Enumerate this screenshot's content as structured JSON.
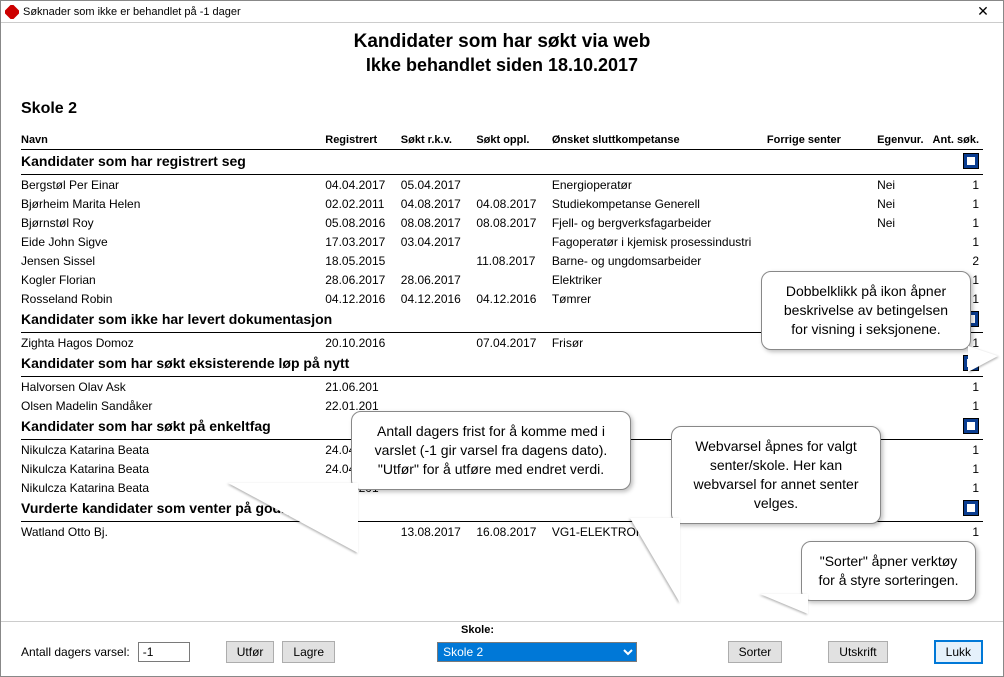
{
  "window": {
    "title": "Søknader som ikke er behandlet på -1 dager",
    "close": "✕"
  },
  "header": {
    "line1": "Kandidater som har søkt via web",
    "line2": "Ikke behandlet siden 18.10.2017"
  },
  "school": "Skole 2",
  "columns": {
    "navn": "Navn",
    "reg": "Registrert",
    "rkv": "Søkt r.k.v.",
    "oppl": "Søkt oppl.",
    "komp": "Ønsket sluttkompetanse",
    "fs": "Forrige senter",
    "eg": "Egenvur.",
    "ant": "Ant. søk."
  },
  "sections": [
    {
      "title": "Kandidater som har registrert seg",
      "rows": [
        {
          "navn": "Bergstøl Per Einar",
          "reg": "04.04.2017",
          "rkv": "05.04.2017",
          "oppl": "",
          "komp": "Energioperatør",
          "fs": "",
          "eg": "Nei",
          "ant": "1"
        },
        {
          "navn": "Bjørheim Marita Helen",
          "reg": "02.02.2011",
          "rkv": "04.08.2017",
          "oppl": "04.08.2017",
          "komp": "Studiekompetanse Generell",
          "fs": "",
          "eg": "Nei",
          "ant": "1"
        },
        {
          "navn": "Bjørnstøl Roy",
          "reg": "05.08.2016",
          "rkv": "08.08.2017",
          "oppl": "08.08.2017",
          "komp": "Fjell- og bergverksfagarbeider",
          "fs": "",
          "eg": "Nei",
          "ant": "1"
        },
        {
          "navn": "Eide John Sigve",
          "reg": "17.03.2017",
          "rkv": "03.04.2017",
          "oppl": "",
          "komp": "Fagoperatør i kjemisk prosessindustri",
          "fs": "",
          "eg": "",
          "ant": "1"
        },
        {
          "navn": "Jensen Sissel",
          "reg": "18.05.2015",
          "rkv": "",
          "oppl": "11.08.2017",
          "komp": "Barne- og ungdomsarbeider",
          "fs": "",
          "eg": "",
          "ant": "2"
        },
        {
          "navn": "Kogler Florian",
          "reg": "28.06.2017",
          "rkv": "28.06.2017",
          "oppl": "",
          "komp": "Elektriker",
          "fs": "",
          "eg": "",
          "ant": "1"
        },
        {
          "navn": "Rosseland Robin",
          "reg": "04.12.2016",
          "rkv": "04.12.2016",
          "oppl": "04.12.2016",
          "komp": "Tømrer",
          "fs": "",
          "eg": "",
          "ant": "1"
        }
      ]
    },
    {
      "title": "Kandidater som ikke har levert dokumentasjon",
      "rows": [
        {
          "navn": "Zighta Hagos Domoz",
          "reg": "20.10.2016",
          "rkv": "",
          "oppl": "07.04.2017",
          "komp": "Frisør",
          "fs": "",
          "eg": "",
          "ant": "1"
        }
      ]
    },
    {
      "title": "Kandidater som har søkt eksisterende løp på nytt",
      "rows": [
        {
          "navn": "Halvorsen Olav Ask",
          "reg": "21.06.201",
          "rkv": "",
          "oppl": "",
          "komp": "",
          "fs": "",
          "eg": "",
          "ant": "1"
        },
        {
          "navn": "Olsen Madelin Sandåker",
          "reg": "22.01.201",
          "rkv": "",
          "oppl": "",
          "komp": "",
          "fs": "",
          "eg": "",
          "ant": "1"
        }
      ]
    },
    {
      "title": "Kandidater som har søkt på enkeltfag",
      "rows": [
        {
          "navn": "Nikulcza Katarina Beata",
          "reg": "24.04.201",
          "rkv": "",
          "oppl": "",
          "komp": "",
          "fs": "",
          "eg": "",
          "ant": "1"
        },
        {
          "navn": "Nikulcza Katarina Beata",
          "reg": "24.04.201",
          "rkv": "",
          "oppl": "",
          "komp": "",
          "fs": "",
          "eg": "",
          "ant": "1"
        },
        {
          "navn": "Nikulcza Katarina Beata",
          "reg": "24.04.201",
          "rkv": "",
          "oppl": "",
          "komp": "",
          "fs": "",
          "eg": "",
          "ant": "1"
        }
      ]
    },
    {
      "title": "Vurderte kandidater som venter på godkj",
      "rows": [
        {
          "navn": "Watland Otto Bj.",
          "reg": "",
          "rkv": "13.08.2017",
          "oppl": "16.08.2017",
          "komp": "VG1-ELEKTROFAG",
          "fs": "",
          "eg": "",
          "ant": "1"
        }
      ]
    }
  ],
  "bottom": {
    "antall_label": "Antall dagers varsel:",
    "antall_value": "-1",
    "utfor": "Utfør",
    "lagre": "Lagre",
    "skole_label": "Skole:",
    "skole_value": "Skole 2",
    "sorter": "Sorter",
    "utskrift": "Utskrift",
    "lukk": "Lukk"
  },
  "callouts": {
    "c1": "Dobbelklikk på ikon åpner beskrivelse av betingelsen for visning i seksjonene.",
    "c2": "Antall dagers frist for å komme med i varslet (-1 gir varsel fra dagens dato). \"Utfør\" for å utføre med endret verdi.",
    "c3": "Webvarsel åpnes for valgt senter/skole. Her kan webvarsel for annet senter velges.",
    "c4": "\"Sorter\" åpner verktøy for å styre sorteringen."
  }
}
